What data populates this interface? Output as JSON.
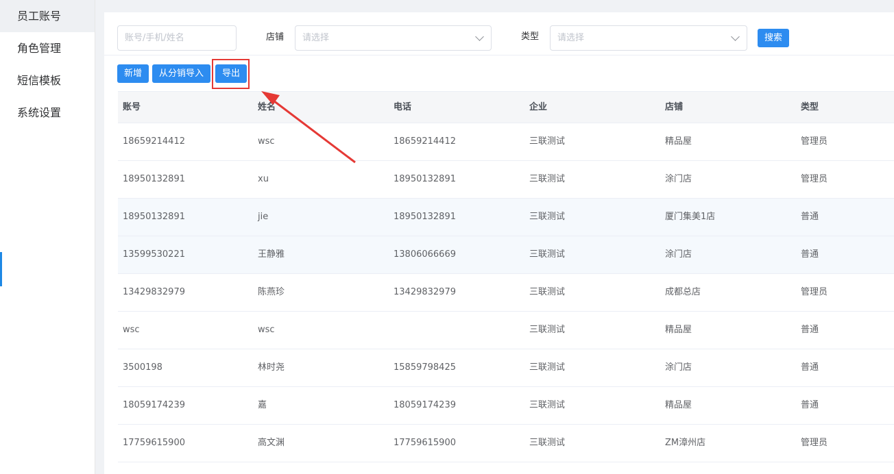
{
  "sidebar": {
    "items": [
      {
        "label": "员工账号"
      },
      {
        "label": "角色管理"
      },
      {
        "label": "短信模板"
      },
      {
        "label": "系统设置"
      }
    ]
  },
  "filters": {
    "account_placeholder": "账号/手机/姓名",
    "store_label": "店铺",
    "store_placeholder": "请选择",
    "type_label": "类型",
    "type_placeholder": "请选择",
    "search_label": "搜索"
  },
  "toolbar": {
    "add_label": "新增",
    "import_label": "从分销导入",
    "export_label": "导出"
  },
  "table": {
    "headers": [
      "账号",
      "姓名",
      "电话",
      "企业",
      "店铺",
      "类型"
    ],
    "rows": [
      [
        "18659214412",
        "wsc",
        "18659214412",
        "三联测试",
        "精品屋",
        "管理员"
      ],
      [
        "18950132891",
        "xu",
        "18950132891",
        "三联测试",
        "涂门店",
        "管理员"
      ],
      [
        "18950132891",
        "jie",
        "18950132891",
        "三联测试",
        "厦门集美1店",
        "普通"
      ],
      [
        "13599530221",
        "王静雅",
        "13806066669",
        "三联测试",
        "涂门店",
        "普通"
      ],
      [
        "13429832979",
        "陈燕珍",
        "13429832979",
        "三联测试",
        "成都总店",
        "管理员"
      ],
      [
        "wsc",
        "wsc",
        "",
        "三联测试",
        "精品屋",
        "普通"
      ],
      [
        "3500198",
        "林时尧",
        "15859798425",
        "三联测试",
        "涂门店",
        "普通"
      ],
      [
        "18059174239",
        "嘉",
        "18059174239",
        "三联测试",
        "精品屋",
        "普通"
      ],
      [
        "17759615900",
        "高文渊",
        "17759615900",
        "三联测试",
        "ZM漳州店",
        "管理员"
      ]
    ]
  },
  "colors": {
    "primary": "#2d8cf0",
    "annotation": "#e53935"
  }
}
